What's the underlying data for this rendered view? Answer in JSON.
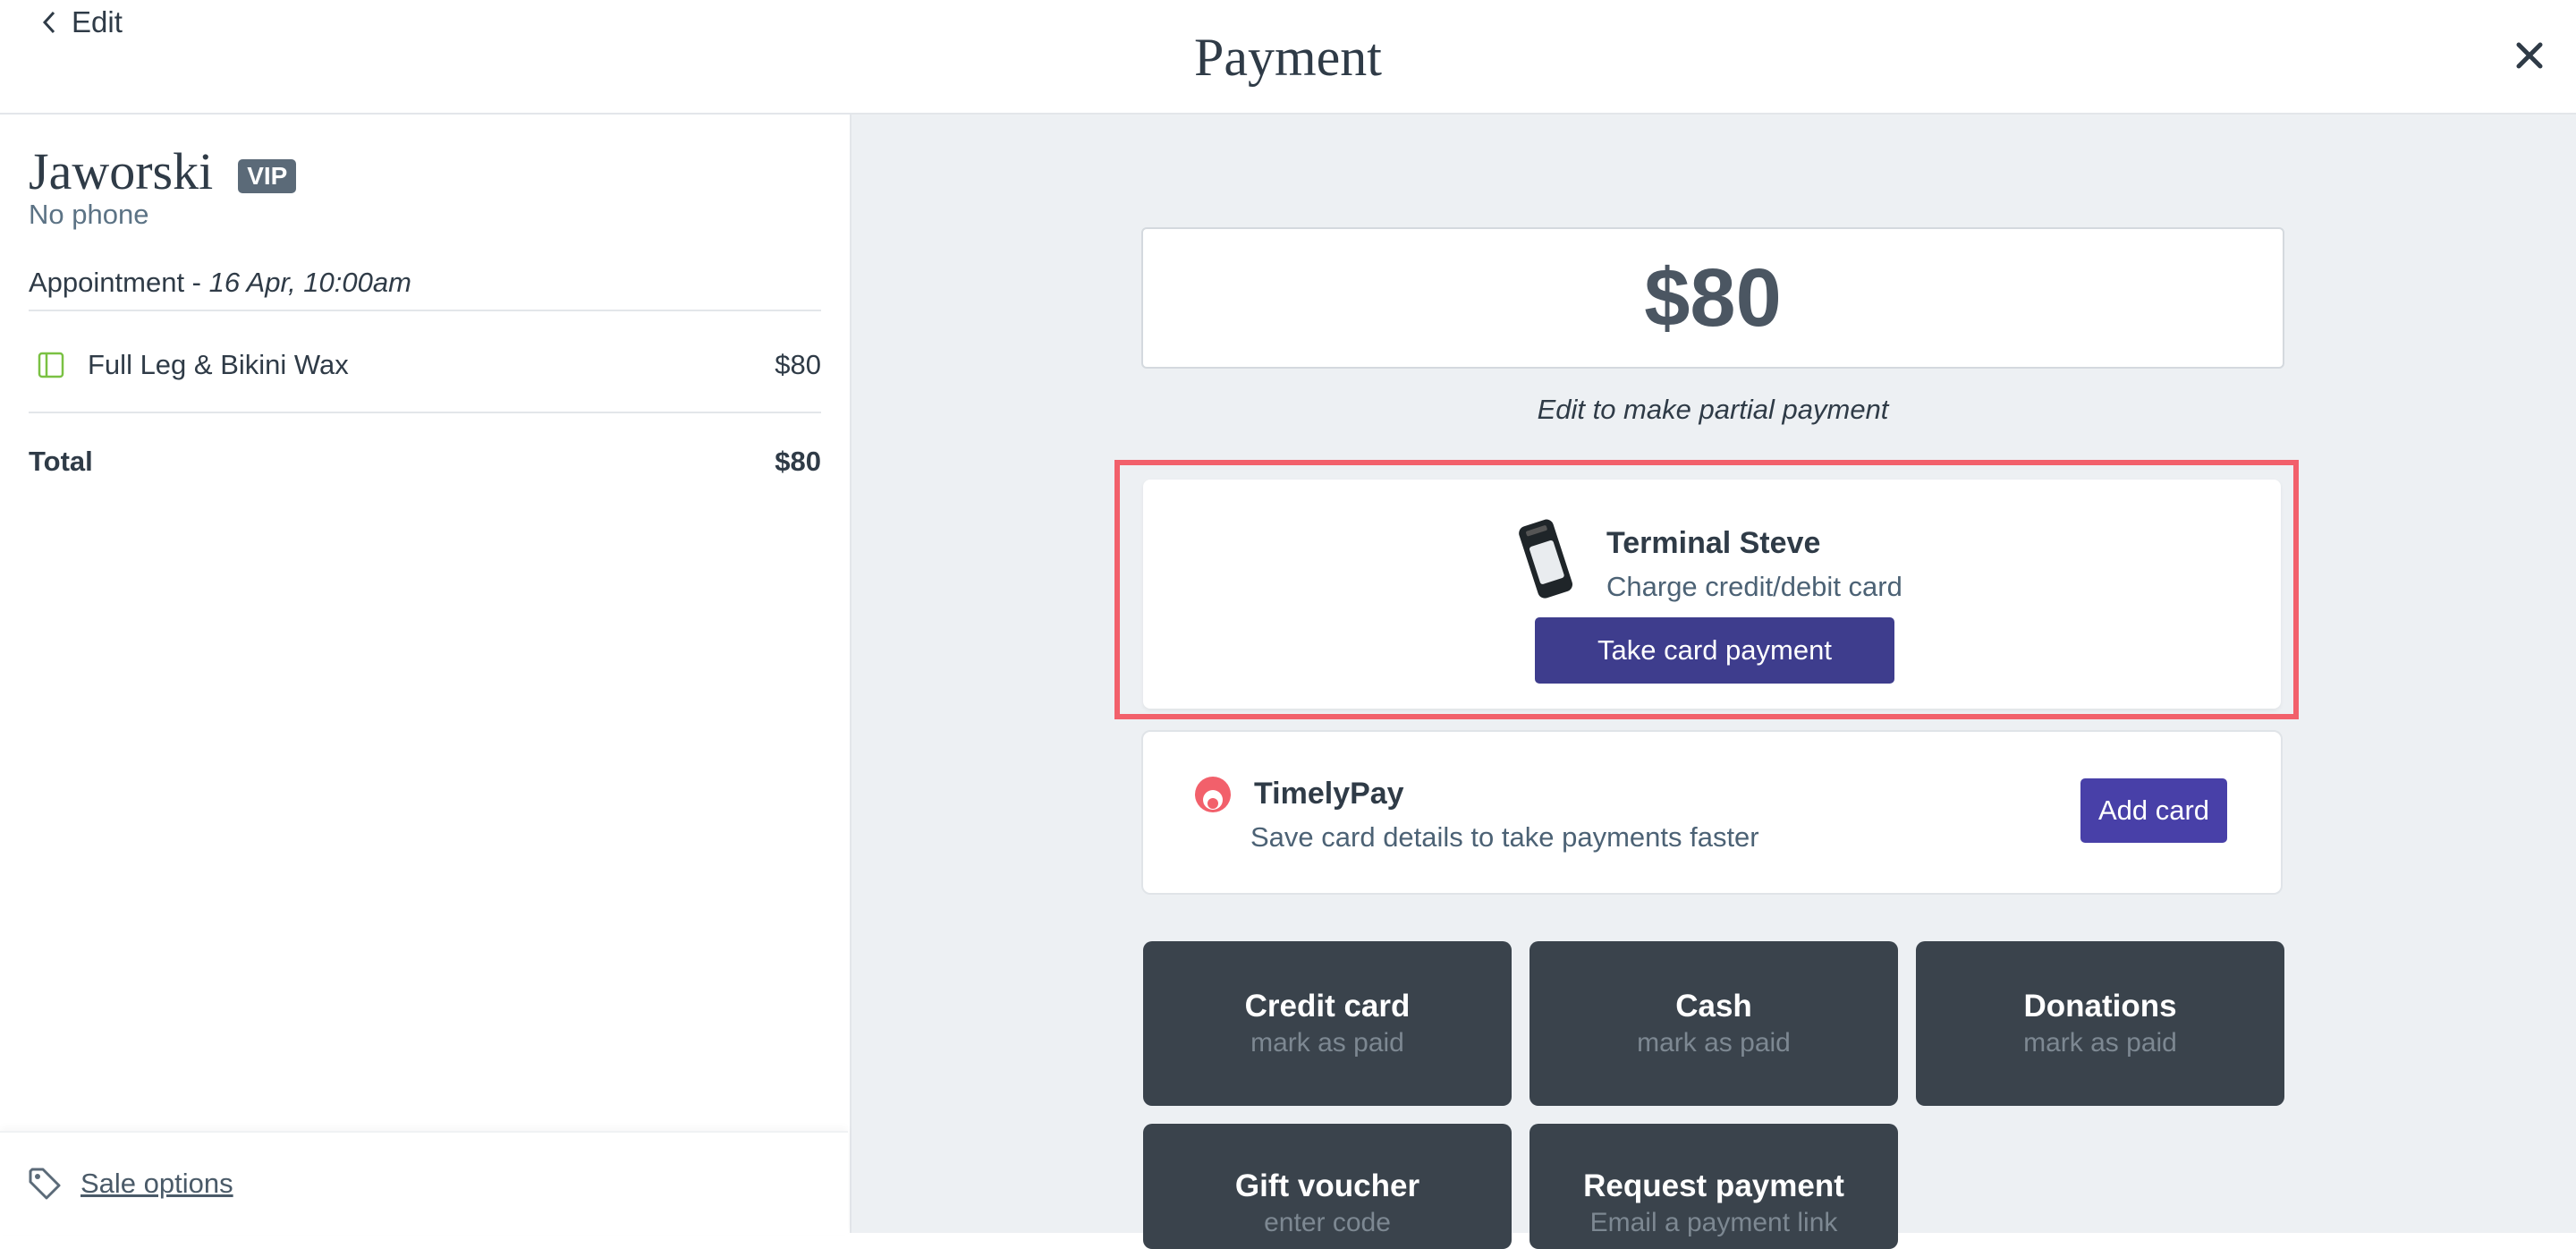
{
  "header": {
    "back_label": "Edit",
    "title": "Payment"
  },
  "customer": {
    "name": "Jaworski",
    "badge": "VIP",
    "phone": "No phone"
  },
  "appointment": {
    "label": "Appointment - ",
    "date": "16 Apr, 10:00am"
  },
  "items": [
    {
      "name": "Full Leg & Bikini Wax",
      "price": "$80"
    }
  ],
  "total": {
    "label": "Total",
    "value": "$80"
  },
  "sale_options_label": "Sale options",
  "amount": "$80",
  "partial_hint": "Edit to make partial payment",
  "terminal": {
    "name": "Terminal Steve",
    "subtitle": "Charge credit/debit card",
    "button": "Take card payment"
  },
  "timelypay": {
    "name": "TimelyPay",
    "subtitle": "Save card details to take payments faster",
    "button": "Add card"
  },
  "payment_methods": [
    {
      "label": "Credit card",
      "sub": "mark as paid"
    },
    {
      "label": "Cash",
      "sub": "mark as paid"
    },
    {
      "label": "Donations",
      "sub": "mark as paid"
    },
    {
      "label": "Gift voucher",
      "sub": "enter code"
    },
    {
      "label": "Request payment",
      "sub": "Email a payment link"
    }
  ],
  "colors": {
    "primary_button": "#3e3d8d",
    "add_card_button": "#4840a8",
    "highlight": "#f2606b",
    "method_tile": "#3a434c",
    "panel_bg": "#edf0f3",
    "service_icon": "#7ac143",
    "timely_icon": "#f2606b"
  },
  "icons": {
    "back": "chevron-left-icon",
    "close": "close-icon",
    "service": "service-icon",
    "tag": "tag-icon",
    "terminal": "card-terminal-icon",
    "timelypay": "timelypay-logo-icon"
  }
}
